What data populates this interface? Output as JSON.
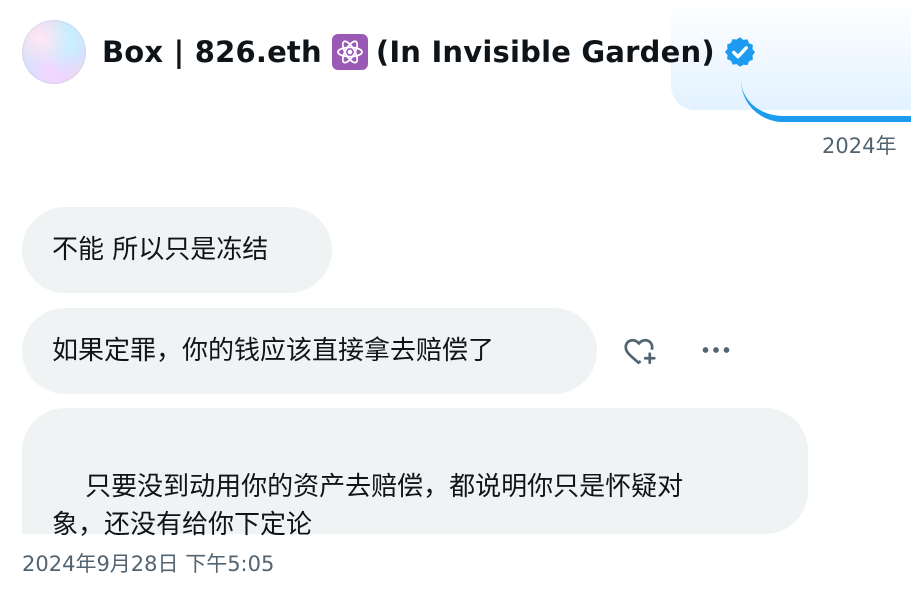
{
  "sender": {
    "name": "Box | 826.eth",
    "name_suffix": "(In Invisible Garden)",
    "avatar_icon": "gradient-avatar",
    "badge_icon": "atom-icon",
    "verified_icon": "verified-badge-icon"
  },
  "timestamps": {
    "top": "2024年",
    "bottom": "2024年9月28日 下午5:05"
  },
  "messages": [
    {
      "text": "不能 所以只是冻结"
    },
    {
      "text": "如果定罪，你的钱应该直接拿去赔偿了"
    },
    {
      "text": "只要没到动用你的资产去赔偿，都说明你只是怀疑对\n象，还没有给你下定论"
    }
  ],
  "actions": {
    "react_icon": "add-reaction-heart-icon",
    "more_icon": "more-options-icon"
  },
  "colors": {
    "bubble_bg": "#eff3f4",
    "text": "#0f1419",
    "secondary_text": "#536471",
    "accent": "#1d9bf0",
    "atom_badge_bg": "#9b59b6"
  }
}
